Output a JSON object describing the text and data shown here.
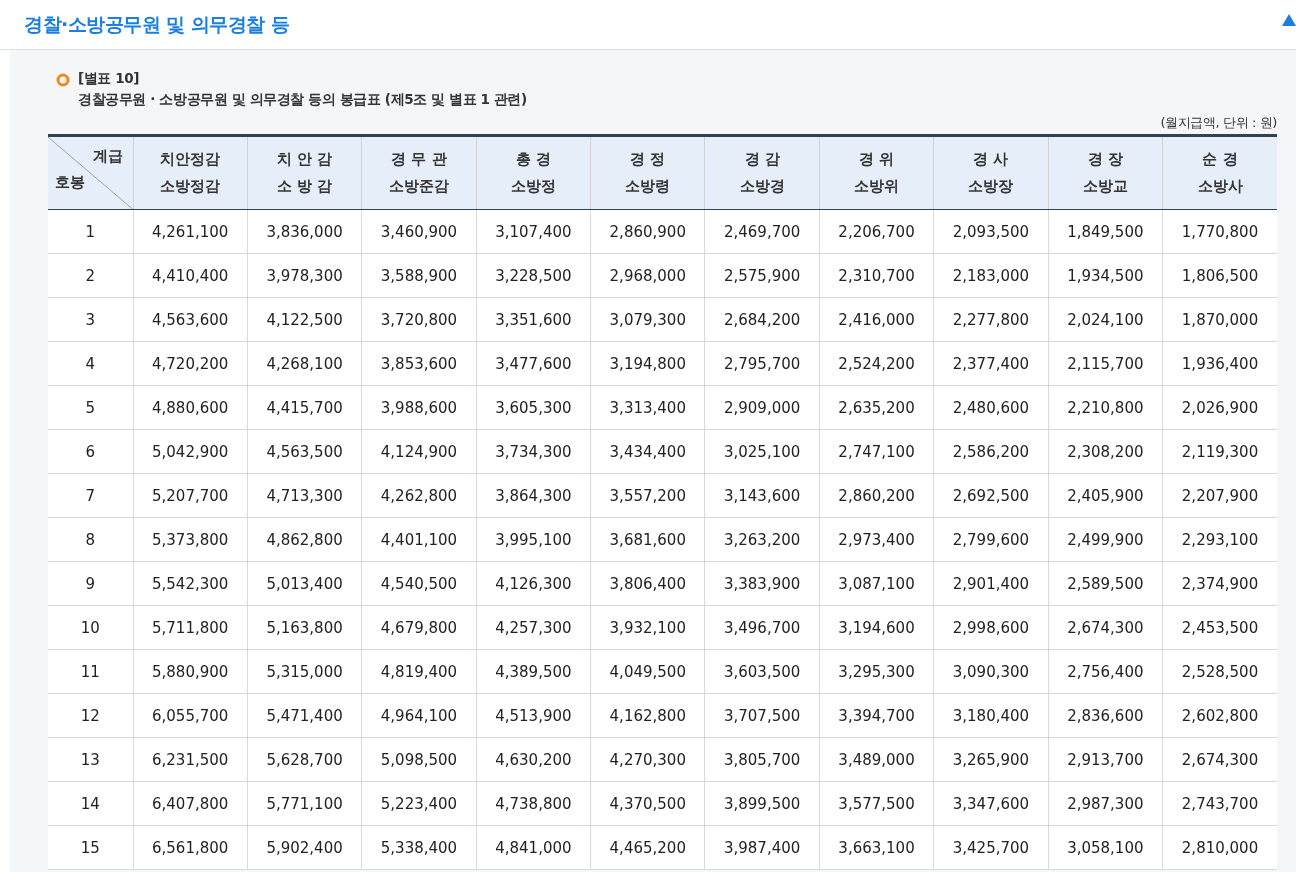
{
  "page_title": "경찰·소방공무원 및 의무경찰 등",
  "section": {
    "label": "[별표 10]",
    "title": "경찰공무원 · 소방공무원 및 의무경찰 등의 봉급표 (제5조 및 별표 1 관련)",
    "unit": "(월지급액, 단위 : 원)"
  },
  "table": {
    "corner": {
      "top": "계급",
      "bottom": "호봉"
    },
    "columns": [
      {
        "line1": "치안정감",
        "line2": "소방정감"
      },
      {
        "line1": "치 안 감",
        "line2": "소 방 감"
      },
      {
        "line1": "경 무 관",
        "line2": "소방준감"
      },
      {
        "line1": "총 경",
        "line2": "소방정"
      },
      {
        "line1": "경 정",
        "line2": "소방령"
      },
      {
        "line1": "경 감",
        "line2": "소방경"
      },
      {
        "line1": "경 위",
        "line2": "소방위"
      },
      {
        "line1": "경 사",
        "line2": "소방장"
      },
      {
        "line1": "경 장",
        "line2": "소방교"
      },
      {
        "line1": "순 경",
        "line2": "소방사"
      }
    ],
    "rows": [
      {
        "step": "1",
        "values": [
          "4,261,100",
          "3,836,000",
          "3,460,900",
          "3,107,400",
          "2,860,900",
          "2,469,700",
          "2,206,700",
          "2,093,500",
          "1,849,500",
          "1,770,800"
        ]
      },
      {
        "step": "2",
        "values": [
          "4,410,400",
          "3,978,300",
          "3,588,900",
          "3,228,500",
          "2,968,000",
          "2,575,900",
          "2,310,700",
          "2,183,000",
          "1,934,500",
          "1,806,500"
        ]
      },
      {
        "step": "3",
        "values": [
          "4,563,600",
          "4,122,500",
          "3,720,800",
          "3,351,600",
          "3,079,300",
          "2,684,200",
          "2,416,000",
          "2,277,800",
          "2,024,100",
          "1,870,000"
        ]
      },
      {
        "step": "4",
        "values": [
          "4,720,200",
          "4,268,100",
          "3,853,600",
          "3,477,600",
          "3,194,800",
          "2,795,700",
          "2,524,200",
          "2,377,400",
          "2,115,700",
          "1,936,400"
        ]
      },
      {
        "step": "5",
        "values": [
          "4,880,600",
          "4,415,700",
          "3,988,600",
          "3,605,300",
          "3,313,400",
          "2,909,000",
          "2,635,200",
          "2,480,600",
          "2,210,800",
          "2,026,900"
        ]
      },
      {
        "step": "6",
        "values": [
          "5,042,900",
          "4,563,500",
          "4,124,900",
          "3,734,300",
          "3,434,400",
          "3,025,100",
          "2,747,100",
          "2,586,200",
          "2,308,200",
          "2,119,300"
        ]
      },
      {
        "step": "7",
        "values": [
          "5,207,700",
          "4,713,300",
          "4,262,800",
          "3,864,300",
          "3,557,200",
          "3,143,600",
          "2,860,200",
          "2,692,500",
          "2,405,900",
          "2,207,900"
        ]
      },
      {
        "step": "8",
        "values": [
          "5,373,800",
          "4,862,800",
          "4,401,100",
          "3,995,100",
          "3,681,600",
          "3,263,200",
          "2,973,400",
          "2,799,600",
          "2,499,900",
          "2,293,100"
        ]
      },
      {
        "step": "9",
        "values": [
          "5,542,300",
          "5,013,400",
          "4,540,500",
          "4,126,300",
          "3,806,400",
          "3,383,900",
          "3,087,100",
          "2,901,400",
          "2,589,500",
          "2,374,900"
        ]
      },
      {
        "step": "10",
        "values": [
          "5,711,800",
          "5,163,800",
          "4,679,800",
          "4,257,300",
          "3,932,100",
          "3,496,700",
          "3,194,600",
          "2,998,600",
          "2,674,300",
          "2,453,500"
        ]
      },
      {
        "step": "11",
        "values": [
          "5,880,900",
          "5,315,000",
          "4,819,400",
          "4,389,500",
          "4,049,500",
          "3,603,500",
          "3,295,300",
          "3,090,300",
          "2,756,400",
          "2,528,500"
        ]
      },
      {
        "step": "12",
        "values": [
          "6,055,700",
          "5,471,400",
          "4,964,100",
          "4,513,900",
          "4,162,800",
          "3,707,500",
          "3,394,700",
          "3,180,400",
          "2,836,600",
          "2,602,800"
        ]
      },
      {
        "step": "13",
        "values": [
          "6,231,500",
          "5,628,700",
          "5,098,500",
          "4,630,200",
          "4,270,300",
          "3,805,700",
          "3,489,000",
          "3,265,900",
          "2,913,700",
          "2,674,300"
        ]
      },
      {
        "step": "14",
        "values": [
          "6,407,800",
          "5,771,100",
          "5,223,400",
          "4,738,800",
          "4,370,500",
          "3,899,500",
          "3,577,500",
          "3,347,600",
          "2,987,300",
          "2,743,700"
        ]
      },
      {
        "step": "15",
        "values": [
          "6,561,800",
          "5,902,400",
          "5,338,400",
          "4,841,000",
          "4,465,200",
          "3,987,400",
          "3,663,100",
          "3,425,700",
          "3,058,100",
          "2,810,000"
        ]
      }
    ]
  }
}
